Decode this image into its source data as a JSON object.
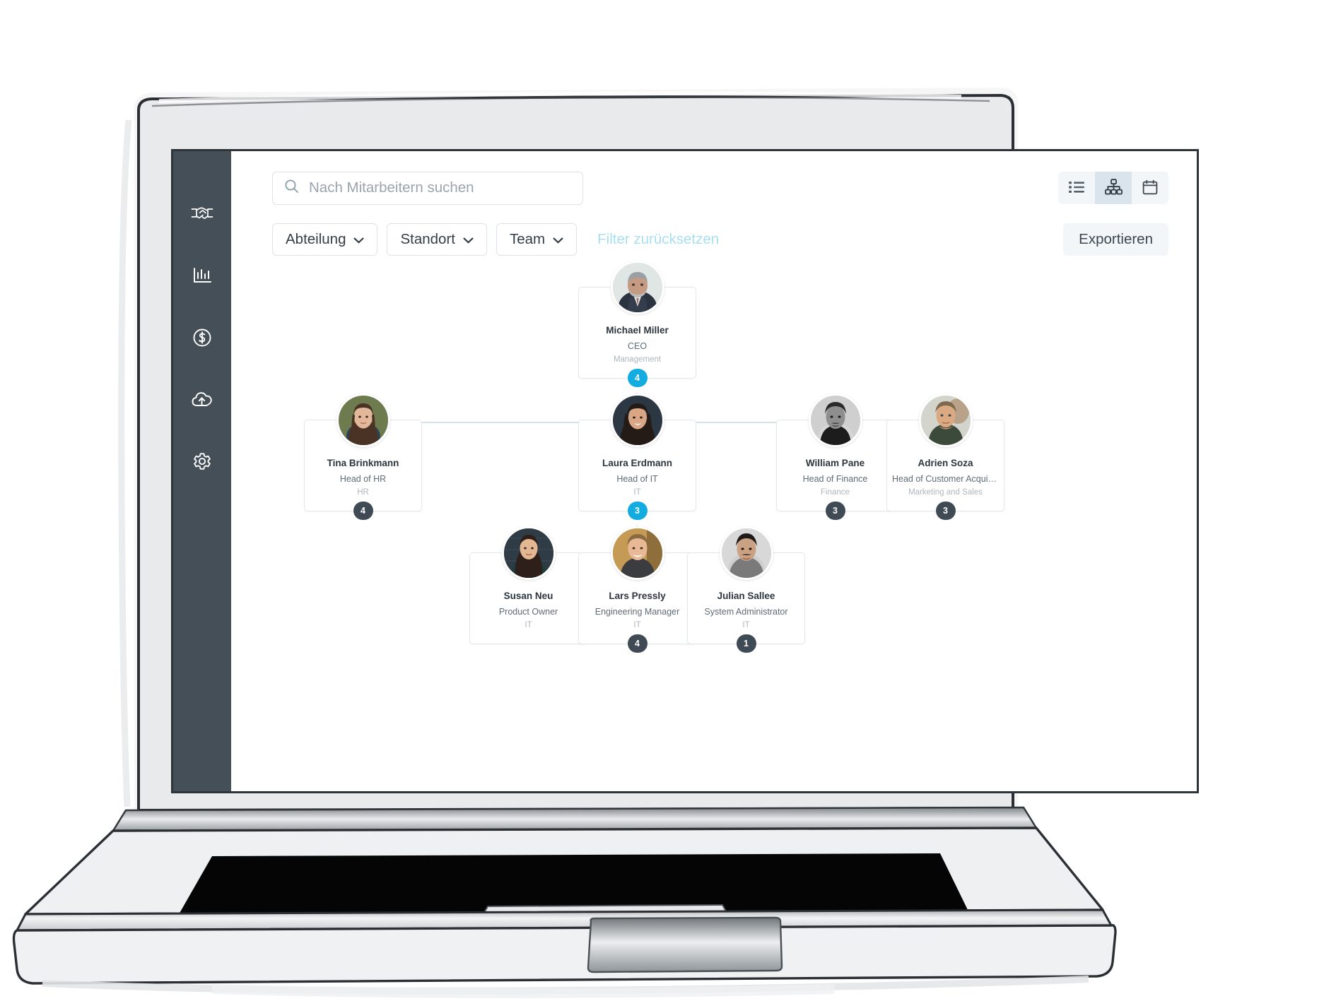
{
  "app": {
    "sidebar": {
      "items": [
        {
          "icon": "handshake-icon",
          "name": "sidebar-item-handshake"
        },
        {
          "icon": "bar-chart-icon",
          "name": "sidebar-item-analytics"
        },
        {
          "icon": "dollar-circle-icon",
          "name": "sidebar-item-payroll"
        },
        {
          "icon": "cloud-upload-icon",
          "name": "sidebar-item-upload"
        },
        {
          "icon": "gear-icon",
          "name": "sidebar-item-settings"
        }
      ]
    },
    "search": {
      "placeholder": "Nach Mitarbeitern suchen",
      "value": "",
      "icon": "search-icon"
    },
    "view_toggle": {
      "options": [
        {
          "icon": "list-view-icon",
          "label": "Liste",
          "active": false
        },
        {
          "icon": "org-chart-icon",
          "label": "Organigramm",
          "active": true
        },
        {
          "icon": "calendar-icon",
          "label": "Kalender",
          "active": false
        }
      ]
    },
    "filters": [
      {
        "label": "Abteilung",
        "icon": "chevron-down-icon"
      },
      {
        "label": "Standort",
        "icon": "chevron-down-icon"
      },
      {
        "label": "Team",
        "icon": "chevron-down-icon"
      }
    ],
    "reset_filter_label": "Filter zurücksetzen",
    "export_label": "Exportieren",
    "colors": {
      "sidebar_bg": "#454f58",
      "accent_cyan": "#12ace0",
      "badge_gray": "#3f4a54",
      "reset_link": "#a8dff0",
      "connector": "#d5e2ec",
      "toggle_active_bg": "#d9e4ec"
    }
  },
  "org_chart": {
    "nodes": [
      {
        "id": "ceo",
        "name": "Michael Miller",
        "role": "CEO",
        "department": "Management",
        "badge": "4",
        "badge_style": "cyan",
        "avatar": "photo-michael-miller"
      },
      {
        "id": "hr",
        "name": "Tina Brinkmann",
        "role": "Head of HR",
        "department": "HR",
        "badge": "4",
        "badge_style": "gray",
        "avatar": "photo-tina-brinkmann"
      },
      {
        "id": "it",
        "name": "Laura Erdmann",
        "role": "Head of IT",
        "department": "IT",
        "badge": "3",
        "badge_style": "cyan",
        "avatar": "photo-laura-erdmann"
      },
      {
        "id": "finance",
        "name": "William Pane",
        "role": "Head of Finance",
        "department": "Finance",
        "badge": "3",
        "badge_style": "gray",
        "avatar": "photo-william-pane"
      },
      {
        "id": "marketing",
        "name": "Adrien Soza",
        "role": "Head of Customer Acquistio…",
        "department": "Marketing and Sales",
        "badge": "3",
        "badge_style": "gray",
        "avatar": "photo-adrien-soza"
      },
      {
        "id": "po",
        "name": "Susan Neu",
        "role": "Product Owner",
        "department": "IT",
        "badge": "",
        "badge_style": "none",
        "avatar": "photo-susan-neu"
      },
      {
        "id": "em",
        "name": "Lars Pressly",
        "role": "Engineering Manager",
        "department": "IT",
        "badge": "4",
        "badge_style": "gray",
        "avatar": "photo-lars-pressly"
      },
      {
        "id": "sysadmin",
        "name": "Julian Sallee",
        "role": "System Administrator",
        "department": "IT",
        "badge": "1",
        "badge_style": "gray",
        "avatar": "photo-julian-sallee"
      }
    ]
  }
}
